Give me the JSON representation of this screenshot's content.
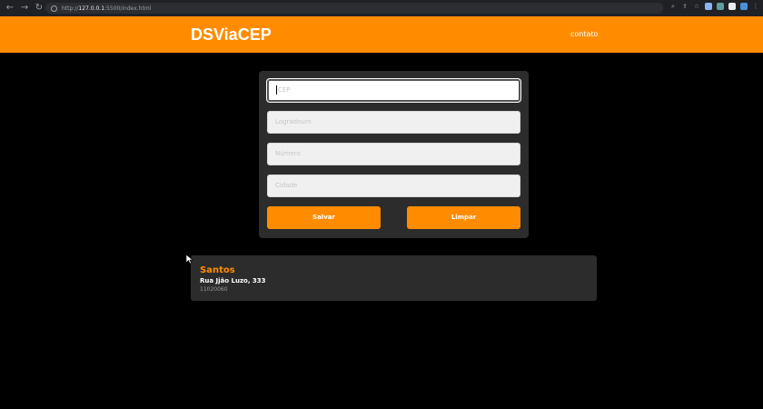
{
  "browser": {
    "url_prefix": "http://",
    "url_host": "127.0.0.1",
    "url_rest": ":5500/index.html"
  },
  "header": {
    "brand": "DSViaCEP",
    "nav_link": "contato"
  },
  "form": {
    "fields": [
      {
        "placeholder": "CEP",
        "value": ""
      },
      {
        "placeholder": "Logradouro",
        "value": ""
      },
      {
        "placeholder": "Número",
        "value": ""
      },
      {
        "placeholder": "Cidade",
        "value": ""
      }
    ],
    "save_label": "Salvar",
    "clear_label": "Limpar"
  },
  "result": {
    "city": "Santos",
    "street": "Rua Jjão Luzo, 333",
    "cep": "11020060"
  },
  "colors": {
    "accent": "#ff8c00",
    "card": "#2c2c2c",
    "background": "#000000"
  }
}
